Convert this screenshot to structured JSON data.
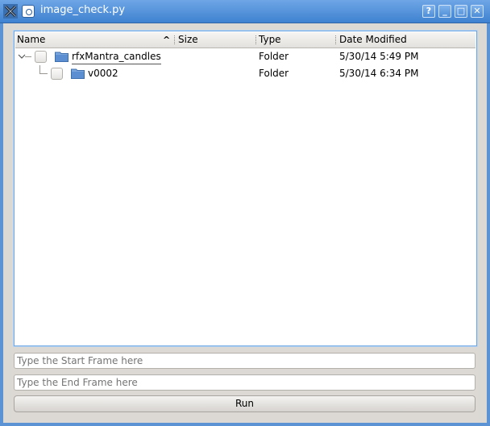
{
  "window": {
    "title": "image_check.py"
  },
  "titlebar": {
    "help_label": "?",
    "minimize_label": "_",
    "maximize_label": "□",
    "close_label": "✕"
  },
  "tree": {
    "columns": [
      "Name",
      "Size",
      "Type",
      "Date Modified"
    ],
    "sort_indicator": "^",
    "rows": [
      {
        "name": "rfxMantra_candles",
        "size": "",
        "type": "Folder",
        "date": "5/30/14 5:49 PM"
      },
      {
        "name": "v0002",
        "size": "",
        "type": "Folder",
        "date": "5/30/14 6:34 PM"
      }
    ]
  },
  "start_frame": {
    "placeholder": "Type the Start Frame here"
  },
  "end_frame": {
    "placeholder": "Type the End Frame here"
  },
  "run_button": {
    "label": "Run"
  },
  "colors": {
    "titlebar": "#4f8ed8",
    "client": "#dcd9d5",
    "folder": "#5b8fd2"
  }
}
